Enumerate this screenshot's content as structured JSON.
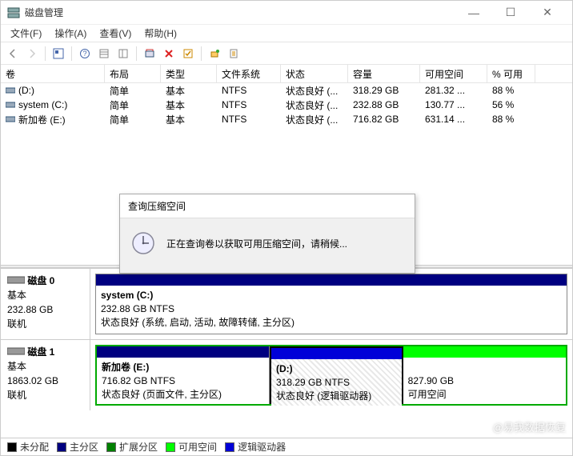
{
  "window": {
    "title": "磁盘管理"
  },
  "menu": {
    "file": "文件(F)",
    "action": "操作(A)",
    "view": "查看(V)",
    "help": "帮助(H)"
  },
  "columns": {
    "vol": "卷",
    "layout": "布局",
    "type": "类型",
    "fs": "文件系统",
    "status": "状态",
    "capacity": "容量",
    "free": "可用空间",
    "pct": "% 可用"
  },
  "volumes": [
    {
      "name": "(D:)",
      "layout": "简单",
      "type": "基本",
      "fs": "NTFS",
      "status": "状态良好 (...",
      "capacity": "318.29 GB",
      "free": "281.32 ...",
      "pct": "88 %"
    },
    {
      "name": "system (C:)",
      "layout": "简单",
      "type": "基本",
      "fs": "NTFS",
      "status": "状态良好 (...",
      "capacity": "232.88 GB",
      "free": "130.77 ...",
      "pct": "56 %"
    },
    {
      "name": "新加卷 (E:)",
      "layout": "简单",
      "type": "基本",
      "fs": "NTFS",
      "status": "状态良好 (...",
      "capacity": "716.82 GB",
      "free": "631.14 ...",
      "pct": "88 %"
    }
  ],
  "dialog": {
    "title": "查询压缩空间",
    "message": "正在查询卷以获取可用压缩空间，请稍候..."
  },
  "disks": [
    {
      "label": "磁盘 0",
      "type": "基本",
      "size": "232.88 GB",
      "state": "联机",
      "parts": [
        {
          "title": "system  (C:)",
          "line2": "232.88 GB NTFS",
          "line3": "状态良好 (系统, 启动, 活动, 故障转储, 主分区)"
        }
      ]
    },
    {
      "label": "磁盘 1",
      "type": "基本",
      "size": "1863.02 GB",
      "state": "联机",
      "parts": [
        {
          "title": "新加卷  (E:)",
          "line2": "716.82 GB NTFS",
          "line3": "状态良好 (页面文件, 主分区)"
        },
        {
          "title": "(D:)",
          "line2": "318.29 GB NTFS",
          "line3": "状态良好 (逻辑驱动器)"
        },
        {
          "title": "",
          "line2": "827.90 GB",
          "line3": "可用空间"
        }
      ]
    }
  ],
  "legend": {
    "unalloc": "未分配",
    "primary": "主分区",
    "ext": "扩展分区",
    "free": "可用空间",
    "logical": "逻辑驱动器"
  },
  "watermark": "@易我数据恢复"
}
